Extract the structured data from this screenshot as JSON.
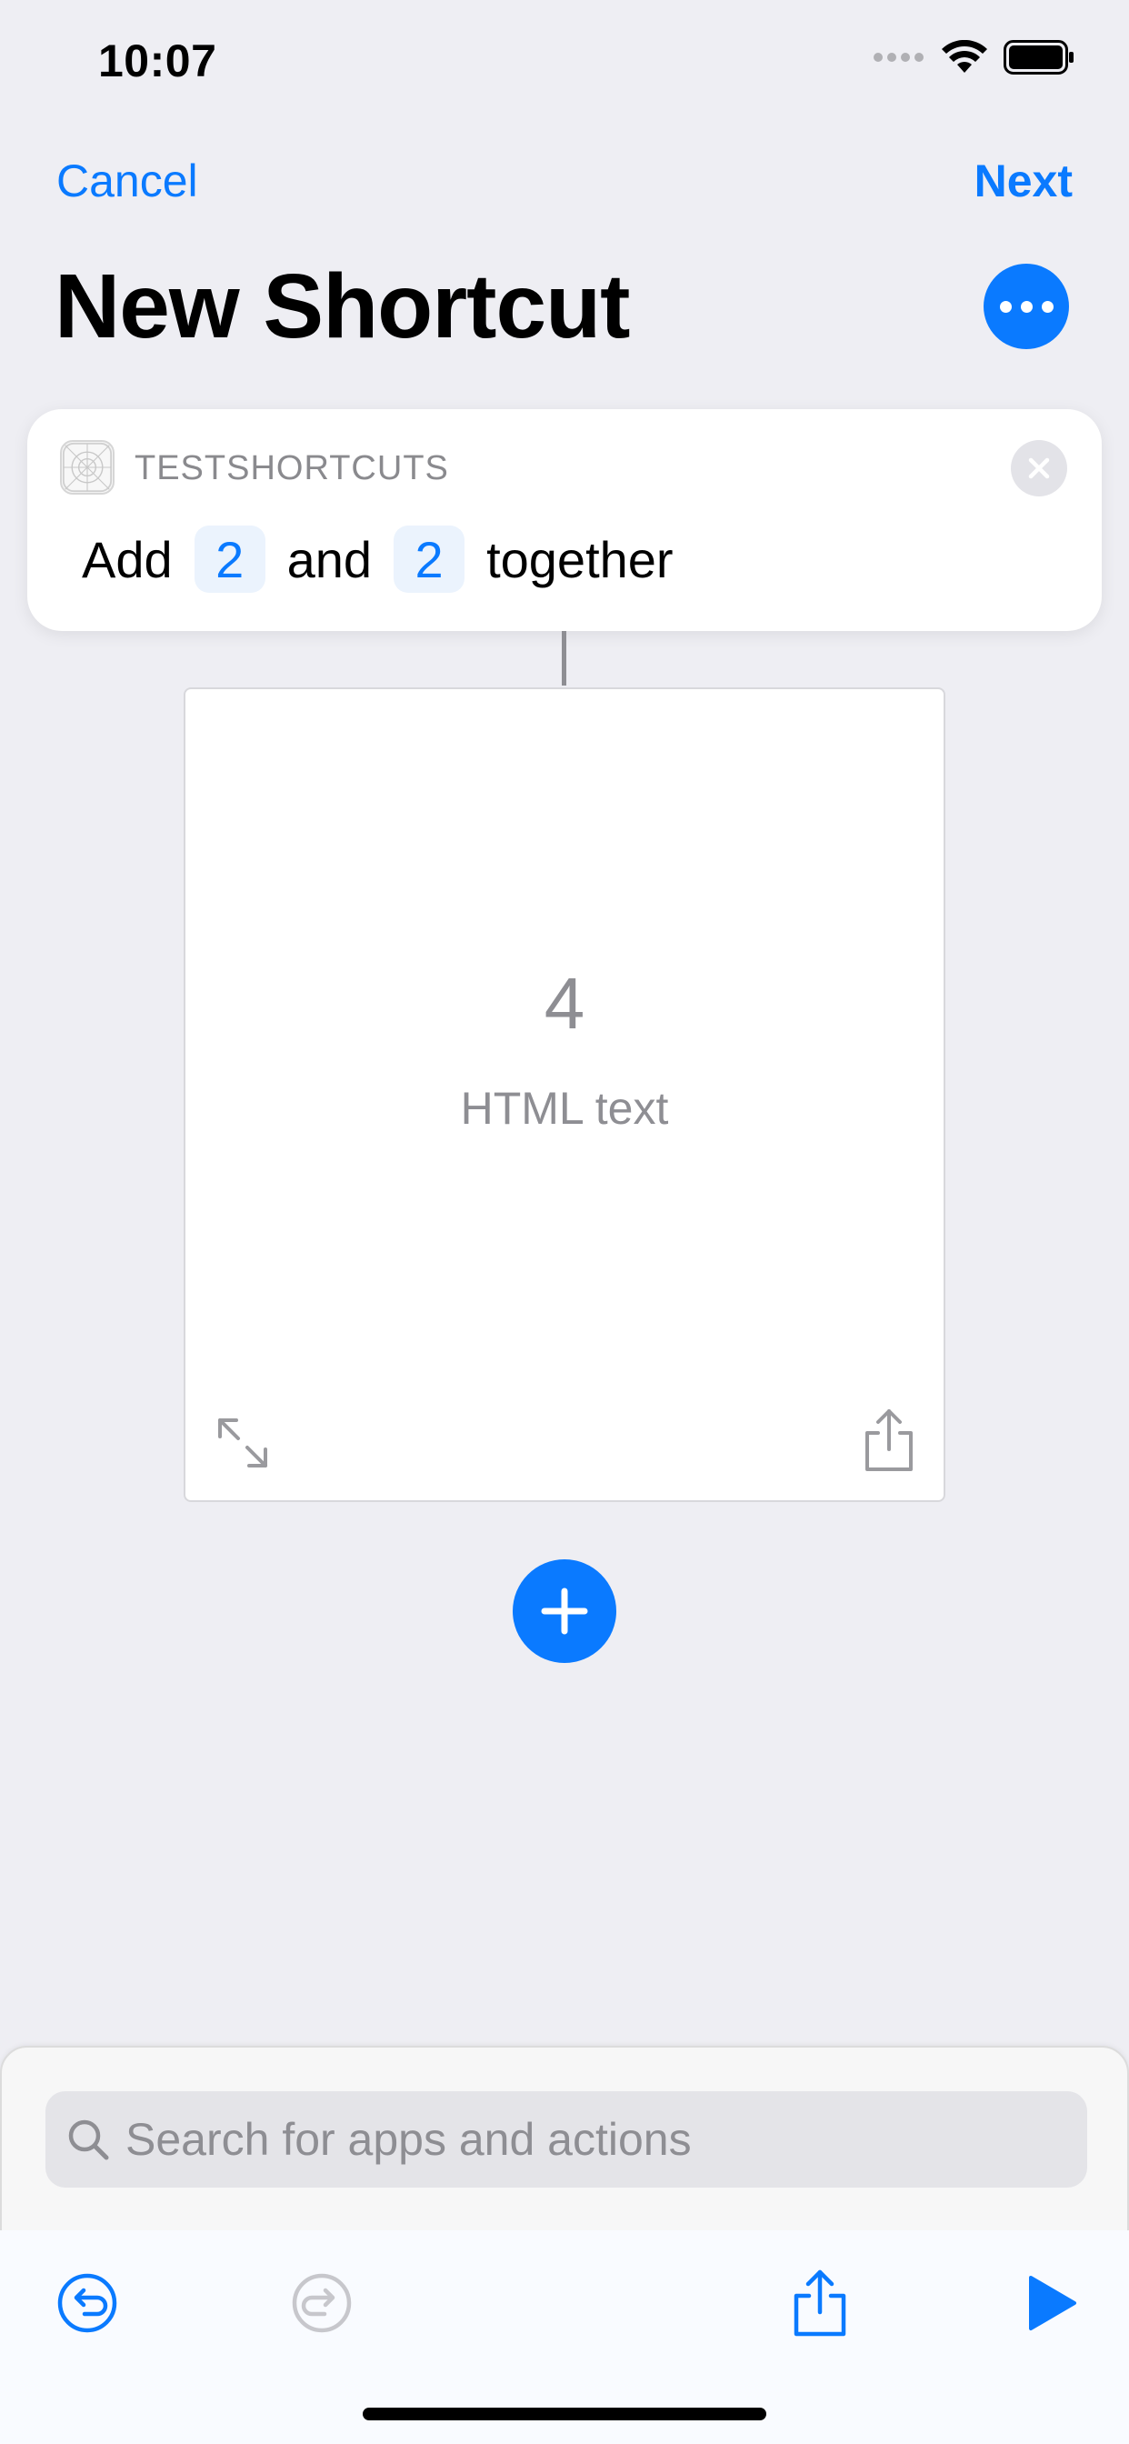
{
  "status_bar": {
    "time": "10:07"
  },
  "nav": {
    "cancel_label": "Cancel",
    "next_label": "Next",
    "title": "New Shortcut"
  },
  "action": {
    "app_name": "TESTSHORTCUTS",
    "sentence": {
      "word1": "Add",
      "value1": "2",
      "word2": "and",
      "value2": "2",
      "word3": "together"
    }
  },
  "result": {
    "value": "4",
    "type_label": "HTML text"
  },
  "search": {
    "placeholder": "Search for apps and actions",
    "value": ""
  },
  "colors": {
    "accent": "#0A7AFF",
    "background": "#EEEEF3",
    "secondary_text": "#8E8E93"
  },
  "icons": {
    "more": "ellipsis-icon",
    "remove": "close-icon",
    "expand": "expand-arrows-icon",
    "share": "share-icon",
    "add": "plus-icon",
    "search": "search-icon",
    "undo": "undo-icon",
    "redo": "redo-icon",
    "run": "play-icon"
  }
}
